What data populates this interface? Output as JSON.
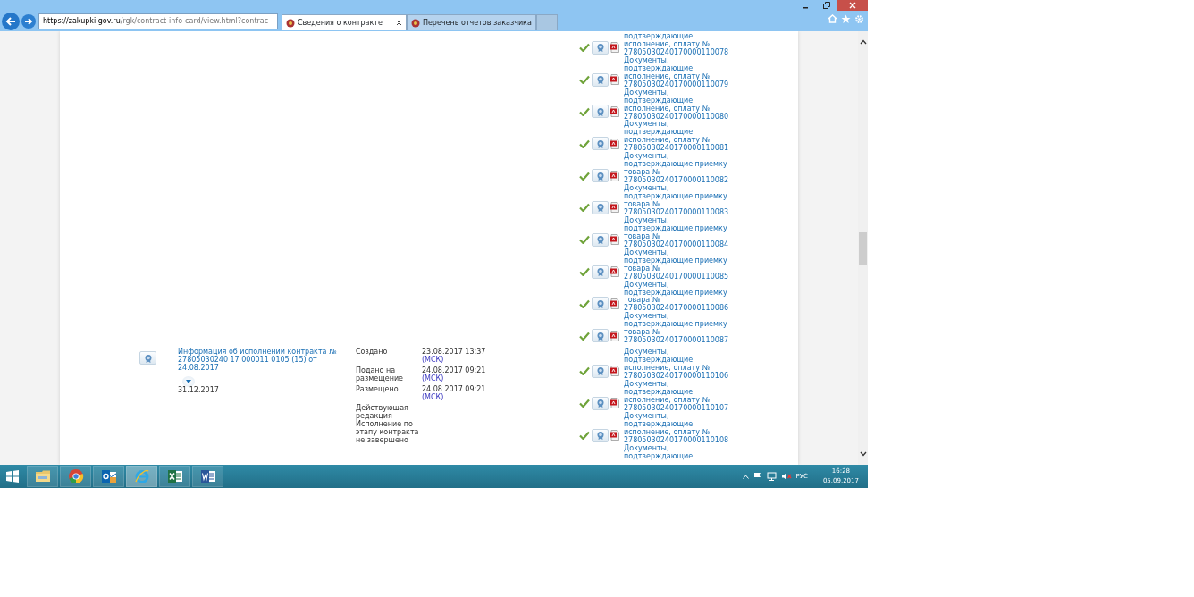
{
  "browser": {
    "address": {
      "host": "https://zakupki.gov.ru",
      "path": "/rgk/contract-info-card/view.html?contrac"
    },
    "tabs": [
      {
        "label": "Сведения о контракте",
        "selected": true
      },
      {
        "label": "Перечень отчетов заказчика",
        "selected": false
      }
    ]
  },
  "documents_top": [
    {
      "text": "подтверждающие\nисполнение, оплату №\n27805030240170000110078"
    },
    {
      "text": "Документы,\nподтверждающие\nисполнение, оплату №\n27805030240170000110079"
    },
    {
      "text": "Документы,\nподтверждающие\nисполнение, оплату №\n27805030240170000110080"
    },
    {
      "text": "Документы,\nподтверждающие\nисполнение, оплату №\n27805030240170000110081"
    },
    {
      "text": "Документы,\nподтверждающие приемку\nтовара №\n27805030240170000110082"
    },
    {
      "text": "Документы,\nподтверждающие приемку\nтовара №\n27805030240170000110083"
    },
    {
      "text": "Документы,\nподтверждающие приемку\nтовара №\n27805030240170000110084"
    },
    {
      "text": "Документы,\nподтверждающие приемку\nтовара №\n27805030240170000110085"
    },
    {
      "text": "Документы,\nподтверждающие приемку\nтовара №\n27805030240170000110086"
    },
    {
      "text": "Документы,\nподтверждающие приемку\nтовара №\n27805030240170000110087"
    }
  ],
  "record": {
    "title": "Информация об исполнении контракта №\n27805030240 17 000011 0105 (15) от 24.08.2017",
    "date": "31.12.2017",
    "events": [
      {
        "label": "Создано",
        "value": "23.08.2017 13:37",
        "zone": "(МСК)"
      },
      {
        "label": "Подано на\nразмещение",
        "value": "24.08.2017 09:21",
        "zone": "(МСК)"
      },
      {
        "label": "Размещено",
        "value": "24.08.2017 09:21",
        "zone": "(МСК)"
      }
    ],
    "status_lines": [
      "Действующая\nредакция",
      "Исполнение по\nэтапу контракта\nне завершено"
    ]
  },
  "documents_bottom": [
    {
      "text": "Документы,\nподтверждающие\nисполнение, оплату №\n27805030240170000110106"
    },
    {
      "text": "Документы,\nподтверждающие\nисполнение, оплату №\n27805030240170000110107"
    },
    {
      "text": "Документы,\nподтверждающие\nисполнение, оплату №\n27805030240170000110108"
    },
    {
      "text": "Документы,\nподтверждающие"
    }
  ],
  "taskbar": {
    "apps": [
      {
        "kind": "folder",
        "selected": false
      },
      {
        "kind": "chrome",
        "selected": false
      },
      {
        "kind": "outlook",
        "selected": false
      },
      {
        "kind": "ie",
        "selected": true
      },
      {
        "kind": "excel",
        "selected": false
      },
      {
        "kind": "word",
        "selected": false
      }
    ],
    "language": "РУС",
    "time": "16:28",
    "date": "05.09.2017"
  }
}
